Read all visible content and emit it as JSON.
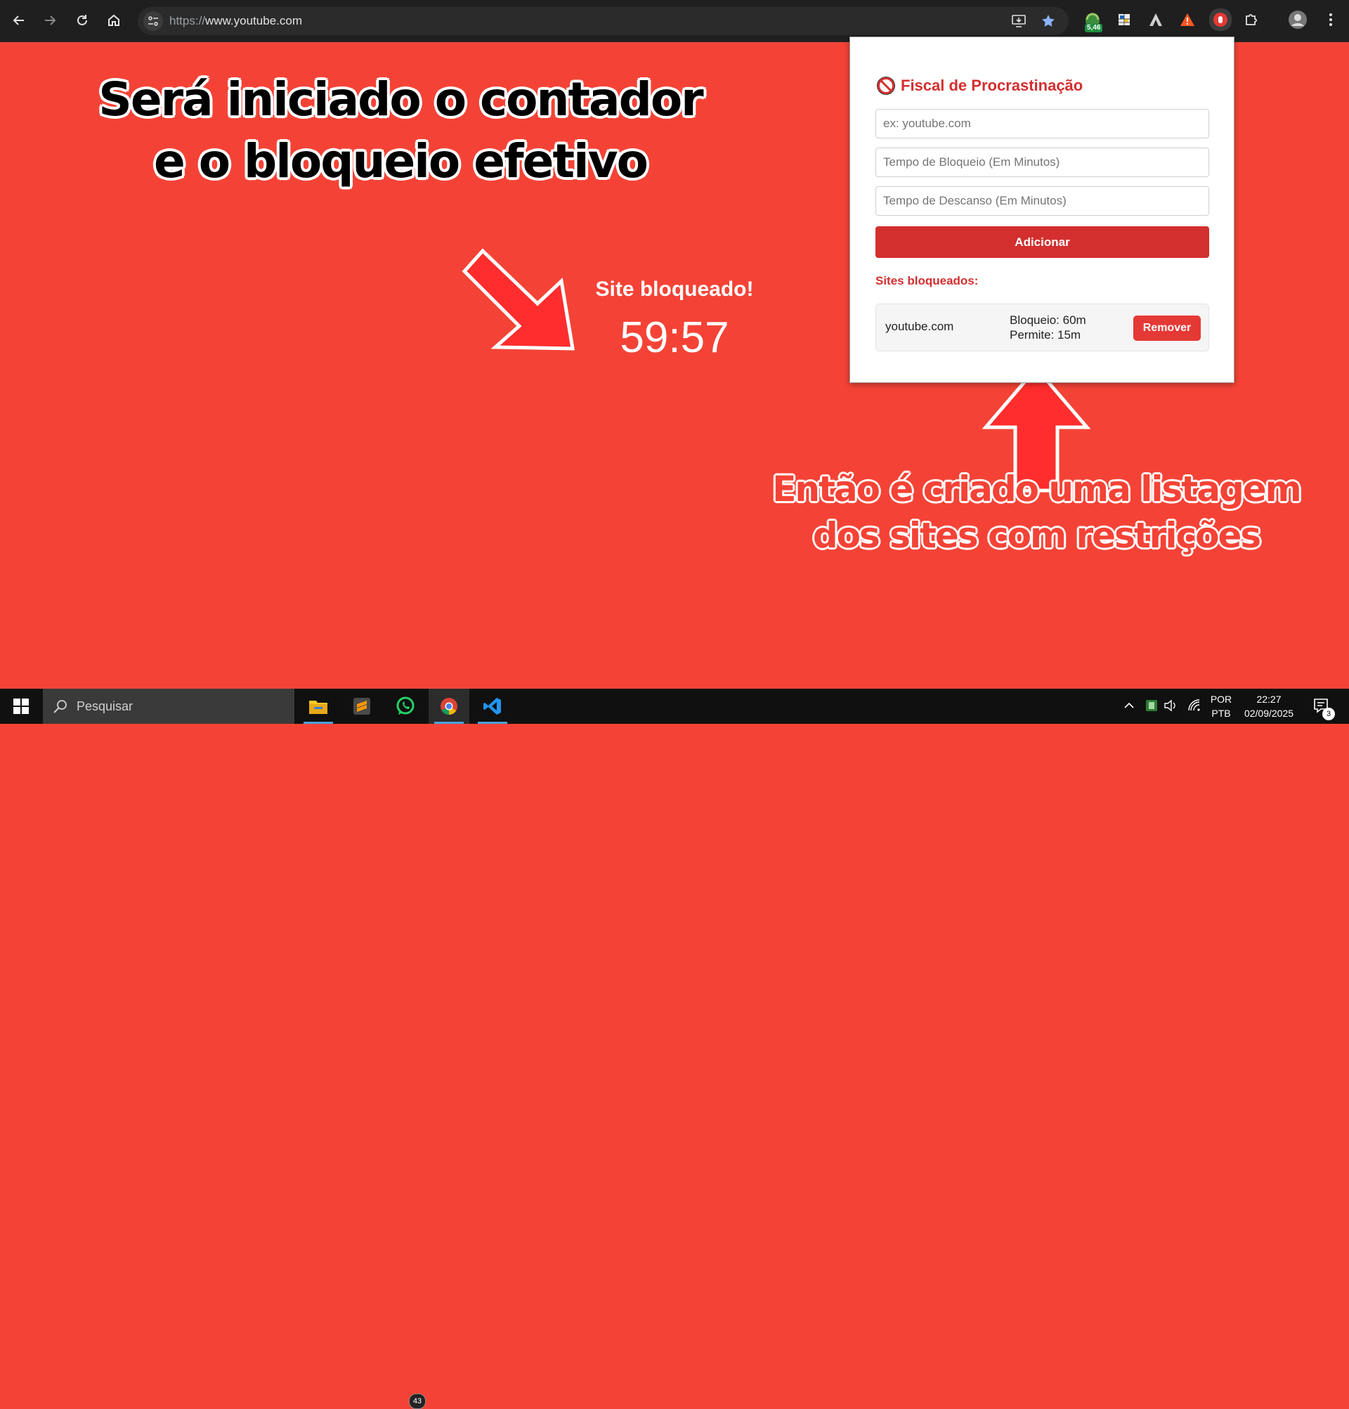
{
  "browser": {
    "url_scheme": "https://",
    "url_host": "www.youtube.com",
    "extension_badge": "5,46"
  },
  "page": {
    "caption_top": "Será iniciado o contador e o bloqueio efetivo",
    "blocked_title": "Site bloqueado!",
    "timer": "59:57",
    "caption_bottom": "Então é criado uma listagem dos sites com restrições"
  },
  "popup": {
    "icon": "prohibited-icon",
    "title": "Fiscal de Procrastinação",
    "site_placeholder": "ex: youtube.com",
    "block_time_placeholder": "Tempo de Bloqueio (Em Minutos)",
    "rest_time_placeholder": "Tempo de Descanso (Em Minutos)",
    "add_label": "Adicionar",
    "list_title": "Sites bloqueados:",
    "sites": [
      {
        "name": "youtube.com",
        "block": "Bloqueio: 60m",
        "allow": "Permite: 15m",
        "remove_label": "Remover"
      }
    ]
  },
  "taskbar": {
    "search_label": "Pesquisar",
    "whatsapp_badge": "43",
    "lang_top": "POR",
    "lang_bottom": "PTB",
    "time": "22:27",
    "date": "02/09/2025",
    "notifications": "3"
  },
  "colors": {
    "page_bg": "#f44336",
    "accent": "#d32f2f",
    "toolbar_bg": "#1f1f1f"
  }
}
